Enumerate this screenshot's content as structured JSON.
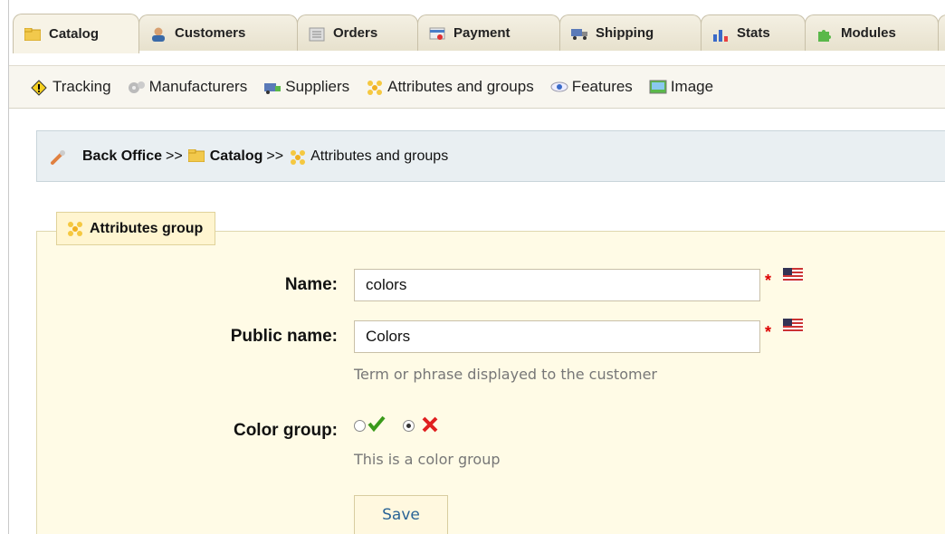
{
  "tabs": [
    {
      "label": "Catalog",
      "icon": "folder-icon",
      "active": true
    },
    {
      "label": "Customers",
      "icon": "customer-icon"
    },
    {
      "label": "Orders",
      "icon": "orders-icon"
    },
    {
      "label": "Payment",
      "icon": "payment-icon"
    },
    {
      "label": "Shipping",
      "icon": "truck-icon"
    },
    {
      "label": "Stats",
      "icon": "bar-chart-icon"
    },
    {
      "label": "Modules",
      "icon": "puzzle-icon"
    }
  ],
  "subnav": [
    {
      "label": "Tracking",
      "icon": "warning-icon"
    },
    {
      "label": "Manufacturers",
      "icon": "gears-icon"
    },
    {
      "label": "Suppliers",
      "icon": "supplier-icon"
    },
    {
      "label": "Attributes and groups",
      "icon": "attributes-icon"
    },
    {
      "label": "Features",
      "icon": "eye-icon"
    },
    {
      "label": "Image",
      "icon": "image-icon"
    }
  ],
  "breadcrumb": {
    "root": "Back Office",
    "sep": ">>",
    "section": "Catalog",
    "current": "Attributes and groups"
  },
  "form": {
    "legend": "Attributes group",
    "name_label": "Name:",
    "name_value": "colors",
    "public_name_label": "Public name:",
    "public_name_value": "Colors",
    "public_name_hint": "Term or phrase displayed to the customer",
    "required_mark": "*",
    "color_group_label": "Color group:",
    "color_group_value": "no",
    "color_group_hint": "This is a color group",
    "save_label": "Save"
  },
  "colors": {
    "accent": "#2a6496",
    "required": "#dd0000",
    "yes": "#3a9a1a",
    "no": "#e02020"
  }
}
